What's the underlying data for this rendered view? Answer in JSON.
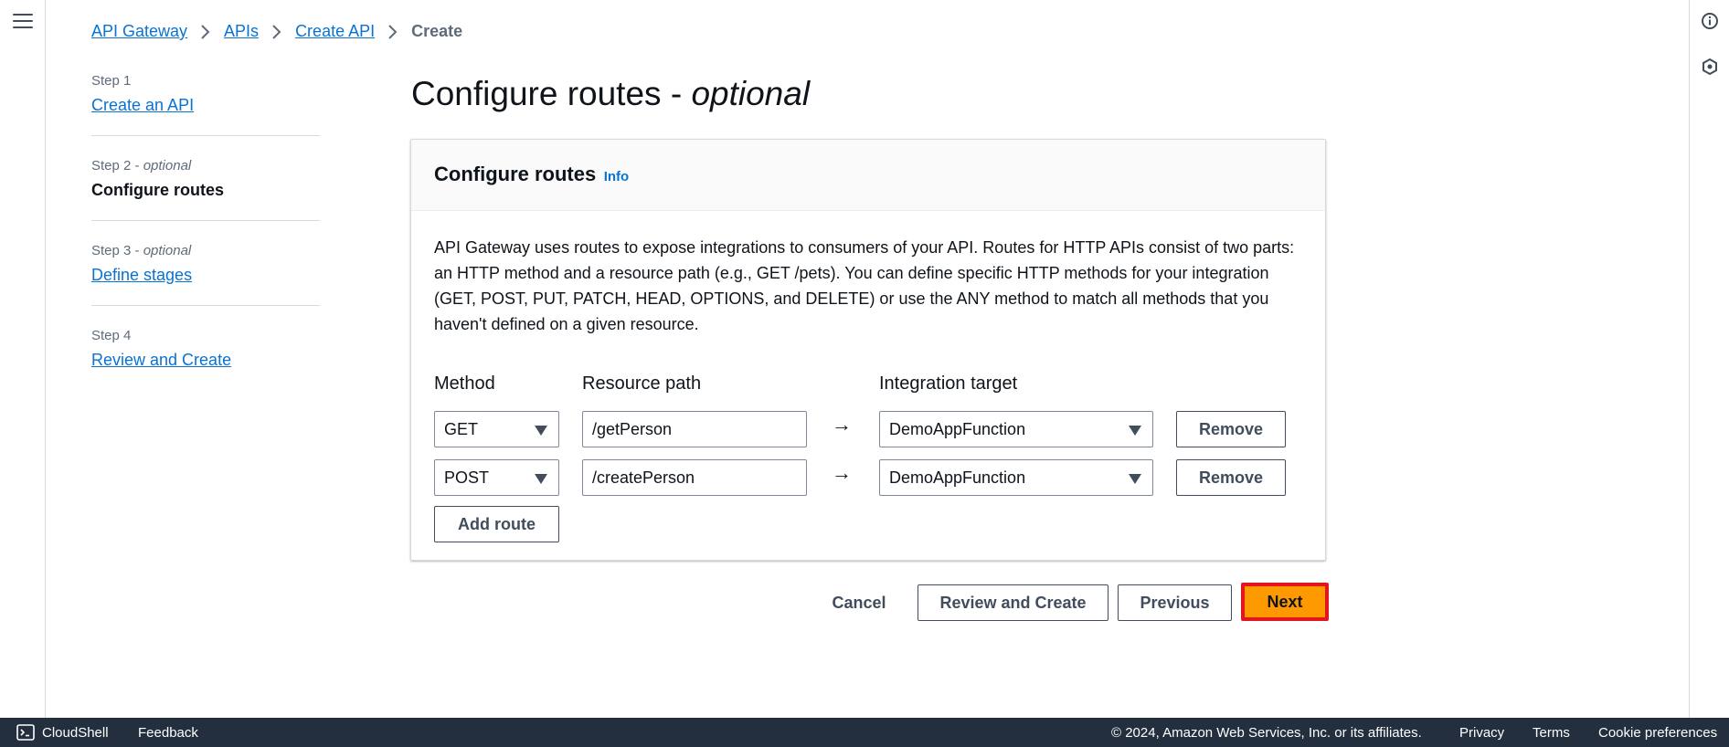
{
  "breadcrumb": {
    "items": [
      "API Gateway",
      "APIs",
      "Create API"
    ],
    "current": "Create"
  },
  "steps": [
    {
      "label": "Step 1",
      "optional": "",
      "title": "Create an API"
    },
    {
      "label": "Step 2 - ",
      "optional": "optional",
      "title": "Configure routes"
    },
    {
      "label": "Step 3 - ",
      "optional": "optional",
      "title": "Define stages"
    },
    {
      "label": "Step 4",
      "optional": "",
      "title": "Review and Create"
    }
  ],
  "page": {
    "title": "Configure routes - ",
    "title_italic": "optional"
  },
  "panel": {
    "title": "Configure routes",
    "info_link": "Info",
    "description": "API Gateway uses routes to expose integrations to consumers of your API. Routes for HTTP APIs consist of two parts: an HTTP method and a resource path (e.g., GET /pets). You can define specific HTTP methods for your integration (GET, POST, PUT, PATCH, HEAD, OPTIONS, and DELETE) or use the ANY method to match all methods that you haven't defined on a given resource.",
    "col_method": "Method",
    "col_resource": "Resource path",
    "col_target": "Integration target",
    "arrow": "→",
    "routes": [
      {
        "method": "GET",
        "path": "/getPerson",
        "target": "DemoAppFunction",
        "remove": "Remove"
      },
      {
        "method": "POST",
        "path": "/createPerson",
        "target": "DemoAppFunction",
        "remove": "Remove"
      }
    ],
    "add_route": "Add route"
  },
  "actions": {
    "cancel": "Cancel",
    "review_create": "Review and Create",
    "previous": "Previous",
    "next": "Next"
  },
  "footer": {
    "cloudshell": "CloudShell",
    "feedback": "Feedback",
    "copyright": "© 2024, Amazon Web Services, Inc. or its affiliates.",
    "privacy": "Privacy",
    "terms": "Terms",
    "cookies": "Cookie preferences"
  },
  "colors": {
    "link": "#0972d3",
    "primary": "#ff9900",
    "highlight_border": "#e4151c",
    "footer_bg": "#232f3e"
  }
}
